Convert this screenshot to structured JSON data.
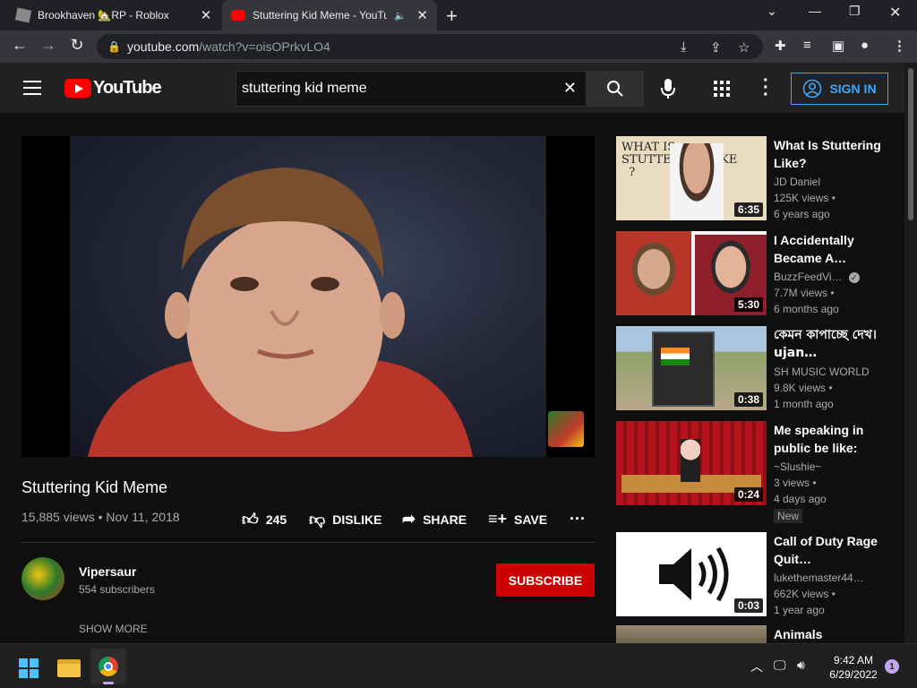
{
  "browser": {
    "tabs": [
      {
        "title": "Brookhaven 🏡RP - Roblox",
        "active": false
      },
      {
        "title": "Stuttering Kid Meme - YouTube",
        "active": true
      }
    ],
    "url_host": "youtube.com",
    "url_path": "/watch?v=oisOPrkvLO4"
  },
  "youtube": {
    "logo_text": "YouTube",
    "search_value": "stuttering kid meme",
    "sign_in_label": "SIGN IN"
  },
  "video": {
    "title": "Stuttering Kid Meme",
    "meta": "15,885 views • Nov 11, 2018",
    "likes": "245",
    "dislike_label": "DISLIKE",
    "share_label": "SHARE",
    "save_label": "SAVE",
    "channel_name": "Vipersaur",
    "subscribers": "554 subscribers",
    "subscribe_label": "SUBSCRIBE",
    "show_more_label": "SHOW MORE"
  },
  "recommendations": [
    {
      "title": "What Is Stuttering Like?",
      "channel": "JD Daniel",
      "views": "125K views •",
      "age": "6 years ago",
      "duration": "6:35",
      "verified": false,
      "badge": ""
    },
    {
      "title": "I Accidentally Became A…",
      "channel": "BuzzFeedVi…",
      "views": "7.7M views •",
      "age": "6 months ago",
      "duration": "5:30",
      "verified": true,
      "badge": ""
    },
    {
      "title": "কেমন কাপাচ্ছে দেখ। ujan…",
      "channel": "SH MUSIC WORLD",
      "views": "9.8K views •",
      "age": "1 month ago",
      "duration": "0:38",
      "verified": false,
      "badge": ""
    },
    {
      "title": "Me speaking in public be like:",
      "channel": "~Slushie~",
      "views": "3 views •",
      "age": "4 days ago",
      "duration": "0:24",
      "verified": false,
      "badge": "New"
    },
    {
      "title": "Call of Duty Rage Quit…",
      "channel": "lukethemaster44…",
      "views": "662K views •",
      "age": "1 year ago",
      "duration": "0:03",
      "verified": false,
      "badge": ""
    },
    {
      "title": "Animals",
      "channel": "",
      "views": "",
      "age": "",
      "duration": "",
      "verified": false,
      "badge": ""
    }
  ],
  "taskbar": {
    "time": "9:42 AM",
    "date": "6/29/2022",
    "notification_count": "1"
  },
  "colors": {
    "youtube_red": "#ff0000",
    "subscribe_red": "#cc0000",
    "signin_blue": "#3ea6ff"
  }
}
